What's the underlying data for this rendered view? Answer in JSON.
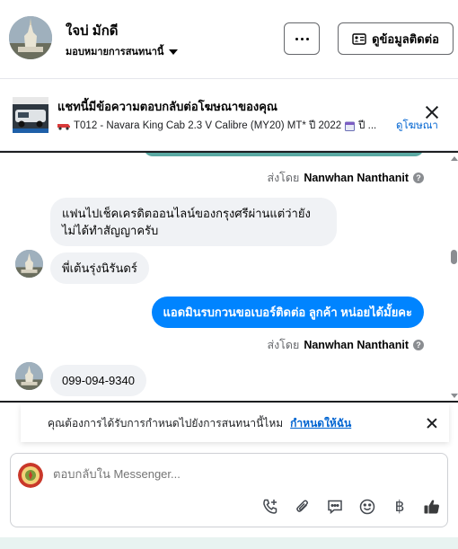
{
  "header": {
    "name": "ใจบ่ มักดี",
    "assign_label": "มอบหมายการสนทนานี้",
    "more_label": "···",
    "contact_label": "ดูข้อมูลติดต่อ"
  },
  "ad": {
    "title": "แชทนี้มีข้อความตอบกลับต่อโฆษณาของคุณ",
    "subtitle": "T012 - Navara King Cab 2.3 V Calibre (MY20) MT* ปี 2022",
    "subtitle_more": "ปี ...",
    "view_ad_label": "ดูโฆษณา"
  },
  "chat": {
    "messages": [
      {
        "direction": "meta",
        "sender_prefix": "ส่งโดย",
        "sender": "Nanwhan Nanthanit"
      },
      {
        "direction": "in",
        "text_line1": "แฟนไปเช็คเครดิตออนไลน์ของกรุงศรีผ่านแต่ว่ายัง",
        "text_line2": "ไม่ได้ทำสัญญาครับ"
      },
      {
        "direction": "in",
        "text": "พี่เต้นรุ่งนิรันดร์"
      },
      {
        "direction": "out",
        "text": "แอดมินรบกวนขอเบอร์ติดต่อ ลูกค้า  หน่อยได้มั้ยคะ"
      },
      {
        "direction": "meta",
        "sender_prefix": "ส่งโดย",
        "sender": "Nanwhan Nanthanit"
      },
      {
        "direction": "in",
        "text": "099-094-9340"
      }
    ],
    "help_glyph": "?"
  },
  "reminder": {
    "text": "คุณต้องการได้รับการกำหนดไปยังการสนทนานี้ไหม",
    "action_label": "กำหนดให้ฉัน"
  },
  "composer": {
    "placeholder": "ตอบกลับใน Messenger...",
    "tools": [
      "call-add-icon",
      "attachment-icon",
      "saved-reply-icon",
      "emoji-icon",
      "baht-icon",
      "like-icon"
    ],
    "baht_glyph": "฿"
  },
  "colors": {
    "accent": "#0084ff",
    "link": "#0064d1",
    "incoming_bubble": "#f0f2f5"
  }
}
